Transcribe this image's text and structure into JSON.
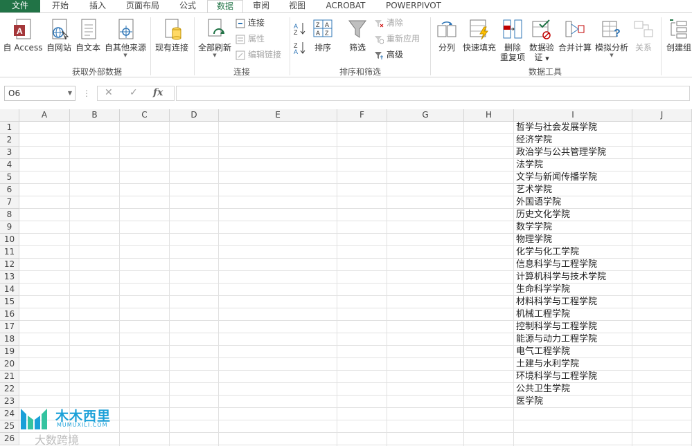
{
  "tabs": [
    "文件",
    "开始",
    "插入",
    "页面布局",
    "公式",
    "数据",
    "审阅",
    "视图",
    "ACROBAT",
    "POWERPIVOT"
  ],
  "ribbon": {
    "groups": {
      "external": "获取外部数据",
      "connections": "连接",
      "sortfilter": "排序和筛选",
      "datatools": "数据工具"
    },
    "buttons": {
      "access": "自 Access",
      "web": "自网站",
      "text": "自文本",
      "other": "自其他来源",
      "existing": "现有连接",
      "refresh": "全部刷新",
      "sort": "排序",
      "filter": "筛选",
      "split": "分列",
      "flashfill": "快速填充",
      "removedup1": "删除",
      "removedup2": "重复项",
      "validate1": "数据验",
      "validate2": "证",
      "consolidate": "合并计算",
      "whatif": "模拟分析",
      "relations": "关系",
      "group": "创建组"
    },
    "small": {
      "connections": "连接",
      "properties": "属性",
      "editlinks": "编辑链接",
      "clear": "清除",
      "reapply": "重新应用",
      "advanced": "高级"
    }
  },
  "formula": {
    "namebox": "O6",
    "fx": "fx",
    "value": ""
  },
  "columns": [
    "A",
    "B",
    "C",
    "D",
    "E",
    "F",
    "G",
    "H",
    "I",
    "J"
  ],
  "rows": [
    "1",
    "2",
    "3",
    "4",
    "5",
    "6",
    "7",
    "8",
    "9",
    "10",
    "11",
    "12",
    "13",
    "14",
    "15",
    "16",
    "17",
    "18",
    "19",
    "20",
    "21",
    "22",
    "23",
    "24",
    "25",
    "26"
  ],
  "column_i": [
    "哲学与社会发展学院",
    "经济学院",
    "政治学与公共管理学院",
    "法学院",
    "文学与新闻传播学院",
    "艺术学院",
    "外国语学院",
    "历史文化学院",
    "数学学院",
    "物理学院",
    "化学与化工学院",
    "信息科学与工程学院",
    "计算机科学与技术学院",
    "生命科学学院",
    "材料科学与工程学院",
    "机械工程学院",
    "控制科学与工程学院",
    "能源与动力工程学院",
    "电气工程学院",
    "土建与水利学院",
    "环境科学与工程学院",
    "公共卫生学院",
    "医学院"
  ],
  "watermark": {
    "brand": "木木西里",
    "url": "MUMUXILI.COM",
    "sub": "大数跨境"
  },
  "colors": {
    "accent": "#217346",
    "watermark": "#1aa0d8"
  }
}
